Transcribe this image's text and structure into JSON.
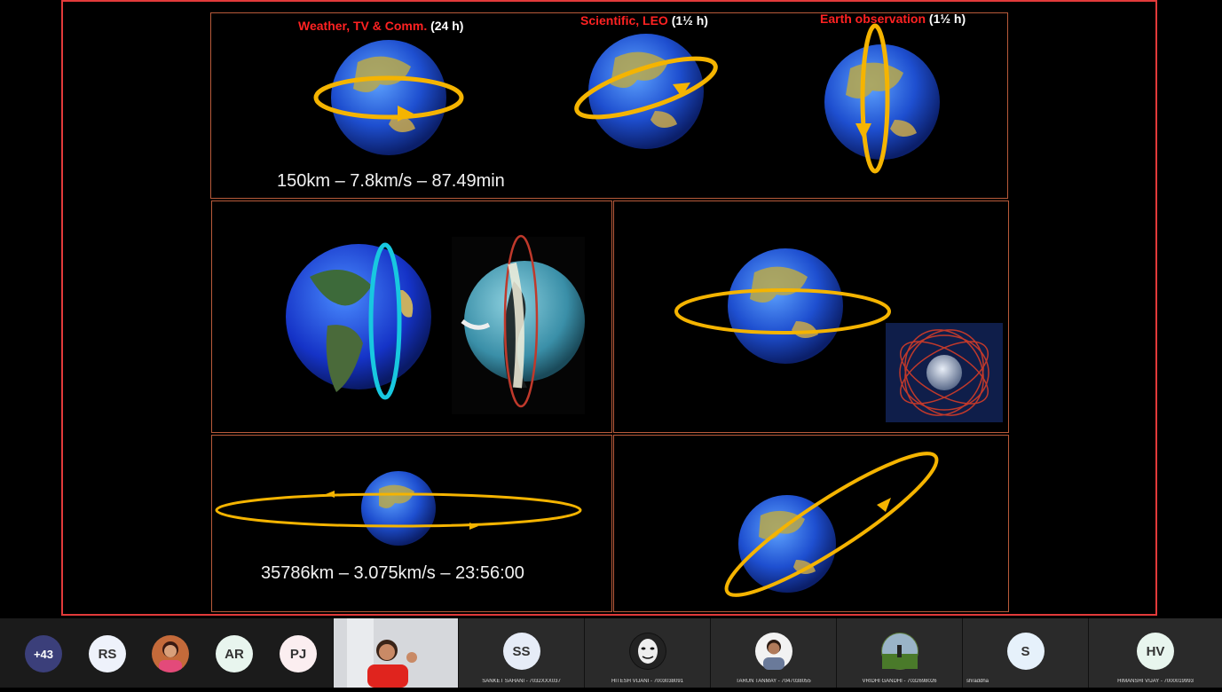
{
  "slide": {
    "top": {
      "label1_red": "Weather, TV & Comm.",
      "label1_white": "(24 h)",
      "label2_red": "Scientific, LEO",
      "label2_white": "(1½ h)",
      "label3_red": "Earth observation",
      "label3_white": "(1½ h)",
      "stat": "150km – 7.8km/s – 87.49min"
    },
    "bottom_left": {
      "stat": "35786km – 3.075km/s – 23:56:00"
    }
  },
  "meeting": {
    "overflow_count": "+43",
    "pills": [
      {
        "initials": "RS",
        "color": "#eef2fb"
      },
      {
        "initials": "AR",
        "color": "#e8f5ee"
      },
      {
        "initials": "PJ",
        "color": "#fbeef0"
      }
    ],
    "tiles": [
      {
        "initials": "SS",
        "name": "SANKET SAHANI - 7032XXX037"
      },
      {
        "initials": "",
        "name": "HITESH VIJANI - 7003038091"
      },
      {
        "initials": "",
        "name": "TARUN TANMAY - 7047038055"
      },
      {
        "initials": "",
        "name": "VRIDHI GANDHI - 7032698026"
      },
      {
        "initials": "S",
        "name": "shraddha"
      },
      {
        "initials": "HV",
        "name": "HIMANSHI VIJAY - 7000019993"
      }
    ]
  }
}
